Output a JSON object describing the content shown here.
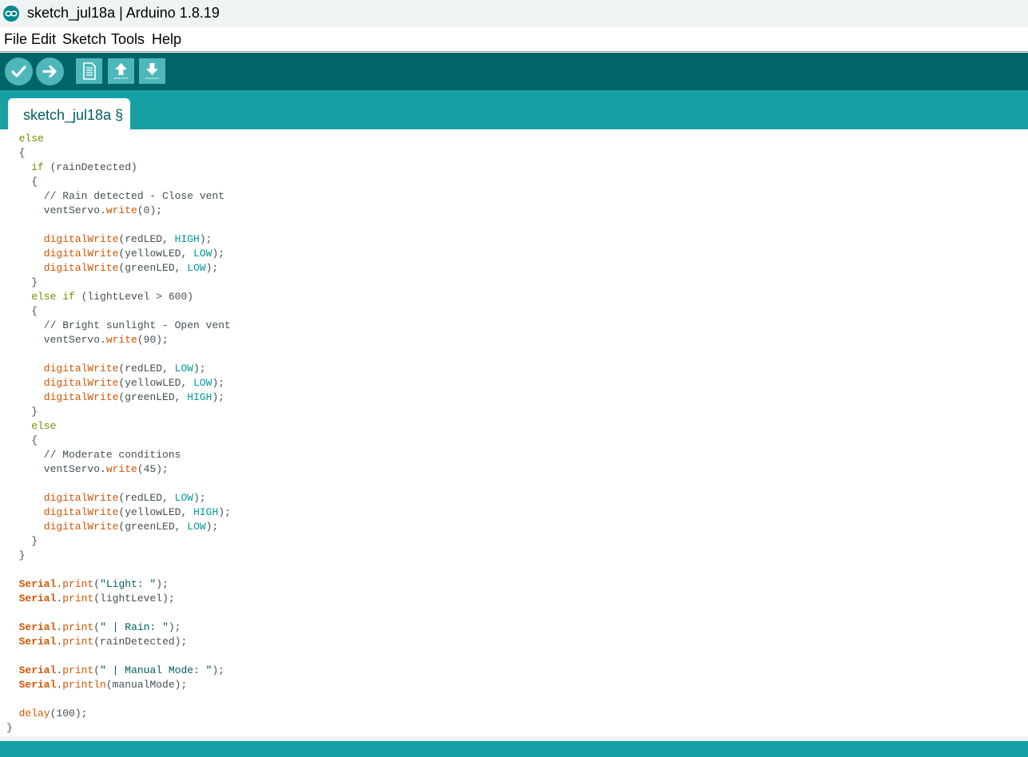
{
  "window": {
    "title": "sketch_jul18a | Arduino 1.8.19",
    "logo_icon": "arduino-logo-icon"
  },
  "menu": {
    "items": [
      "File",
      "Edit",
      "Sketch",
      "Tools",
      "Help"
    ]
  },
  "toolbar": {
    "buttons": [
      {
        "name": "verify",
        "icon": "checkmark-icon"
      },
      {
        "name": "upload",
        "icon": "arrow-right-icon"
      },
      {
        "name": "new",
        "icon": "new-file-icon"
      },
      {
        "name": "open",
        "icon": "arrow-up-icon"
      },
      {
        "name": "save",
        "icon": "arrow-down-icon"
      }
    ]
  },
  "tabs": [
    {
      "label": "sketch_jul18a §",
      "active": true
    }
  ],
  "colors": {
    "toolbar_bg": "#006468",
    "tabstrip_bg": "#17a1a5",
    "button_bg": "#4db7bb",
    "keyword": "#728e00",
    "function": "#d35400",
    "constant": "#00979c"
  },
  "code": [
    [
      [
        "k",
        "  else"
      ]
    ],
    [
      [
        "p",
        "  {"
      ]
    ],
    [
      [
        "k",
        "    if"
      ],
      [
        "p",
        " (rainDetected)"
      ]
    ],
    [
      [
        "p",
        "    {"
      ]
    ],
    [
      [
        "c",
        "      // Rain detected - Close vent"
      ]
    ],
    [
      [
        "p",
        "      ventServo."
      ],
      [
        "f",
        "write"
      ],
      [
        "p",
        "(0);"
      ]
    ],
    [
      [
        "p",
        ""
      ]
    ],
    [
      [
        "f",
        "      digitalWrite"
      ],
      [
        "p",
        "(redLED, "
      ],
      [
        "n",
        "HIGH"
      ],
      [
        "p",
        ");"
      ]
    ],
    [
      [
        "f",
        "      digitalWrite"
      ],
      [
        "p",
        "(yellowLED, "
      ],
      [
        "n",
        "LOW"
      ],
      [
        "p",
        ");"
      ]
    ],
    [
      [
        "f",
        "      digitalWrite"
      ],
      [
        "p",
        "(greenLED, "
      ],
      [
        "n",
        "LOW"
      ],
      [
        "p",
        ");"
      ]
    ],
    [
      [
        "p",
        "    }"
      ]
    ],
    [
      [
        "k",
        "    else if"
      ],
      [
        "p",
        " (lightLevel > 600)"
      ]
    ],
    [
      [
        "p",
        "    {"
      ]
    ],
    [
      [
        "c",
        "      // Bright sunlight - Open vent"
      ]
    ],
    [
      [
        "p",
        "      ventServo."
      ],
      [
        "f",
        "write"
      ],
      [
        "p",
        "(90);"
      ]
    ],
    [
      [
        "p",
        ""
      ]
    ],
    [
      [
        "f",
        "      digitalWrite"
      ],
      [
        "p",
        "(redLED, "
      ],
      [
        "n",
        "LOW"
      ],
      [
        "p",
        ");"
      ]
    ],
    [
      [
        "f",
        "      digitalWrite"
      ],
      [
        "p",
        "(yellowLED, "
      ],
      [
        "n",
        "LOW"
      ],
      [
        "p",
        ");"
      ]
    ],
    [
      [
        "f",
        "      digitalWrite"
      ],
      [
        "p",
        "(greenLED, "
      ],
      [
        "n",
        "HIGH"
      ],
      [
        "p",
        ");"
      ]
    ],
    [
      [
        "p",
        "    }"
      ]
    ],
    [
      [
        "k",
        "    else"
      ]
    ],
    [
      [
        "p",
        "    {"
      ]
    ],
    [
      [
        "c",
        "      // Moderate conditions"
      ]
    ],
    [
      [
        "p",
        "      ventServo."
      ],
      [
        "f",
        "write"
      ],
      [
        "p",
        "(45);"
      ]
    ],
    [
      [
        "p",
        ""
      ]
    ],
    [
      [
        "f",
        "      digitalWrite"
      ],
      [
        "p",
        "(redLED, "
      ],
      [
        "n",
        "LOW"
      ],
      [
        "p",
        ");"
      ]
    ],
    [
      [
        "f",
        "      digitalWrite"
      ],
      [
        "p",
        "(yellowLED, "
      ],
      [
        "n",
        "HIGH"
      ],
      [
        "p",
        ");"
      ]
    ],
    [
      [
        "f",
        "      digitalWrite"
      ],
      [
        "p",
        "(greenLED, "
      ],
      [
        "n",
        "LOW"
      ],
      [
        "p",
        ");"
      ]
    ],
    [
      [
        "p",
        "    }"
      ]
    ],
    [
      [
        "p",
        "  }"
      ]
    ],
    [
      [
        "p",
        ""
      ]
    ],
    [
      [
        "s",
        "  Serial"
      ],
      [
        "p",
        "."
      ],
      [
        "f",
        "print"
      ],
      [
        "p",
        "("
      ],
      [
        "t",
        "\"Light: \""
      ],
      [
        "p",
        ");"
      ]
    ],
    [
      [
        "s",
        "  Serial"
      ],
      [
        "p",
        "."
      ],
      [
        "f",
        "print"
      ],
      [
        "p",
        "(lightLevel);"
      ]
    ],
    [
      [
        "p",
        ""
      ]
    ],
    [
      [
        "s",
        "  Serial"
      ],
      [
        "p",
        "."
      ],
      [
        "f",
        "print"
      ],
      [
        "p",
        "("
      ],
      [
        "t",
        "\" | Rain: \""
      ],
      [
        "p",
        ");"
      ]
    ],
    [
      [
        "s",
        "  Serial"
      ],
      [
        "p",
        "."
      ],
      [
        "f",
        "print"
      ],
      [
        "p",
        "(rainDetected);"
      ]
    ],
    [
      [
        "p",
        ""
      ]
    ],
    [
      [
        "s",
        "  Serial"
      ],
      [
        "p",
        "."
      ],
      [
        "f",
        "print"
      ],
      [
        "p",
        "("
      ],
      [
        "t",
        "\" | Manual Mode: \""
      ],
      [
        "p",
        ");"
      ]
    ],
    [
      [
        "s",
        "  Serial"
      ],
      [
        "p",
        "."
      ],
      [
        "f",
        "println"
      ],
      [
        "p",
        "(manualMode);"
      ]
    ],
    [
      [
        "p",
        ""
      ]
    ],
    [
      [
        "f",
        "  delay"
      ],
      [
        "p",
        "(100);"
      ]
    ],
    [
      [
        "p",
        "}"
      ]
    ]
  ]
}
